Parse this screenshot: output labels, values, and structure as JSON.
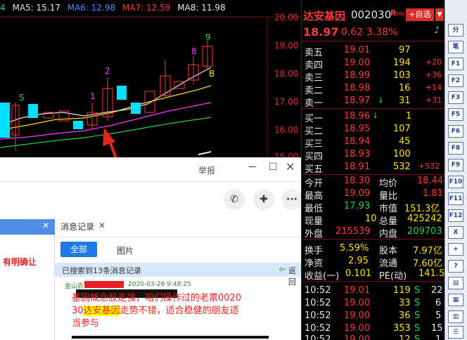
{
  "ma_bar": {
    "ma4": "4",
    "ma5": "MA5: 15.17",
    "ma6": "MA6: 12.98",
    "ma7": "MA7: 12.59",
    "ma8": "MA8: 11.98",
    "colors": {
      "ma4": "#21d44a",
      "ma5": "#e8e8e8",
      "ma6": "#4d8dff",
      "ma7": "#ff3b3b",
      "ma8": "#e8e8e8"
    }
  },
  "y_axis": [
    "20.00",
    "19.00",
    "18.00",
    "17.00",
    "16.00",
    "15.00"
  ],
  "chart_marks": {
    "s_label": "S",
    "b_label": "B",
    "num_labels": [
      "1",
      "2",
      "8",
      "9"
    ]
  },
  "quote": {
    "name": "达安基因",
    "code": "002030",
    "r500": "R",
    "r500b": "500",
    "add_btn": "+自选",
    "price": "18.97",
    "change": "0.62",
    "pct": "3.38%",
    "sell": [
      {
        "label": "卖五",
        "price": "19.01",
        "vol": "97",
        "delta": ""
      },
      {
        "label": "卖四",
        "price": "19.00",
        "vol": "194",
        "delta": "+20"
      },
      {
        "label": "卖三",
        "price": "18.99",
        "vol": "103",
        "delta": "+36"
      },
      {
        "label": "卖二",
        "price": "18.98",
        "vol": "16",
        "delta": "+14"
      },
      {
        "label": "卖一",
        "price": "18.97",
        "vol": "31",
        "delta": "+31"
      }
    ],
    "buy": [
      {
        "label": "买一",
        "price": "18.96",
        "vol": "1",
        "delta": ""
      },
      {
        "label": "买二",
        "price": "18.95",
        "vol": "107",
        "delta": ""
      },
      {
        "label": "买三",
        "price": "18.94",
        "vol": "45",
        "delta": ""
      },
      {
        "label": "买四",
        "price": "18.93",
        "vol": "100",
        "delta": ""
      },
      {
        "label": "买五",
        "price": "18.91",
        "vol": "532",
        "delta": "+532"
      }
    ],
    "stats": [
      {
        "l1": "今开",
        "v1": "18.30",
        "l2": "均价",
        "v2": "18.44"
      },
      {
        "l1": "最高",
        "v1": "19.09",
        "l2": "量比",
        "v2": "1.81"
      },
      {
        "l1": "最低",
        "v1": "17.93",
        "l2": "市值",
        "v2": "151.3亿"
      },
      {
        "l1": "现量",
        "v1": "10",
        "l2": "总量",
        "v2": "425242"
      },
      {
        "l1": "外盘",
        "v1": "215539",
        "l2": "内盘",
        "v2": "209703"
      }
    ],
    "stats2": [
      {
        "l1": "换手",
        "v1": "5.59%",
        "l2": "股本",
        "v2": "7.97亿"
      },
      {
        "l1": "净资",
        "v1": "2.95",
        "l2": "流通",
        "v2": "7.60亿"
      },
      {
        "l1": "收益(一)",
        "v1": "0.101",
        "l2": "PE(动)",
        "v2": "141.5"
      }
    ],
    "ticks": [
      {
        "t": "10:52",
        "p": "19.01",
        "v": "119",
        "d": "S",
        "n": "22"
      },
      {
        "t": "10:52",
        "p": "19.00",
        "v": "33",
        "d": "S",
        "n": "6"
      },
      {
        "t": "10:52",
        "p": "19.00",
        "v": "36",
        "d": "S",
        "n": "5"
      },
      {
        "t": "10:52",
        "p": "19.00",
        "v": "353",
        "d": "S",
        "n": "15"
      },
      {
        "t": "10:52",
        "p": "19.00",
        "v": "12",
        "d": "S",
        "n": "1"
      }
    ]
  },
  "rbar": [
    "分",
    "笔",
    "F1",
    "F2",
    "F3",
    "F5",
    "F6",
    "F8",
    "F9",
    "F10",
    "F11",
    "F12",
    "X",
    "+",
    "?"
  ],
  "chat": {
    "title_report": "举报",
    "left_text": "有明确让",
    "tab_record": "消息记录",
    "tab_all": "全部",
    "tab_pic": "图片",
    "search_result": "已搜索到13条消息记录",
    "back": "返回",
    "sender": "金山农",
    "timestamp": "2020-03-26 9:48:25",
    "msg1": "基因概念股走强，咱们操作过的老票0020",
    "msg2a": "30",
    "msg2b": "达安基因",
    "msg2c": "走势不错，适合稳健的朋友适",
    "msg3": "当参与"
  }
}
